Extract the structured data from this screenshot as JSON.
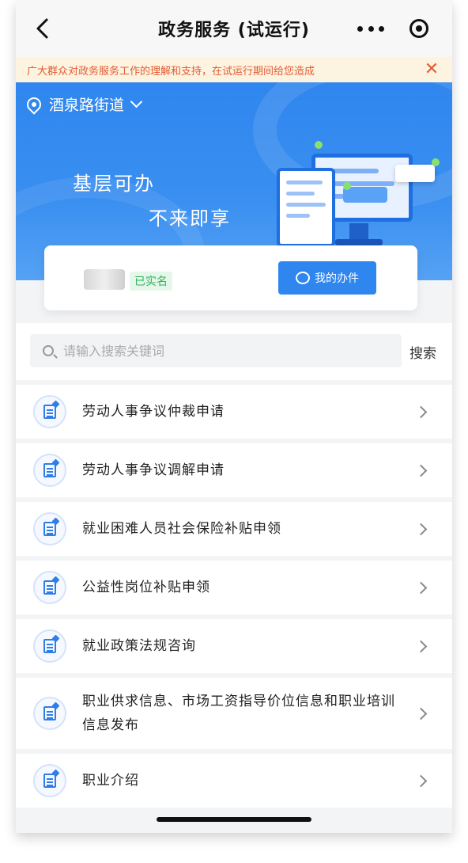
{
  "header": {
    "title": "政务服务 (试运行)"
  },
  "notice": {
    "text": "广大群众对政务服务工作的理解和支持，在试运行期间给您造成"
  },
  "banner": {
    "location": "酒泉路街道",
    "slogan_line1": "基层可办",
    "slogan_line2": "不来即享"
  },
  "profile": {
    "verified_label": "已实名",
    "my_services_label": "我的办件"
  },
  "search": {
    "placeholder": "请输入搜索关键词",
    "button_label": "搜索"
  },
  "services": [
    {
      "label": "劳动人事争议仲裁申请"
    },
    {
      "label": "劳动人事争议调解申请"
    },
    {
      "label": "就业困难人员社会保险补贴申领"
    },
    {
      "label": "公益性岗位补贴申领"
    },
    {
      "label": "就业政策法规咨询"
    },
    {
      "label": "职业供求信息、市场工资指导价位信息和职业培训信息发布"
    },
    {
      "label": "职业介绍"
    }
  ],
  "colors": {
    "primary": "#2f86ee",
    "notice_text": "#e25d33",
    "notice_bg": "#fdf3e1",
    "verified": "#31b35a"
  }
}
